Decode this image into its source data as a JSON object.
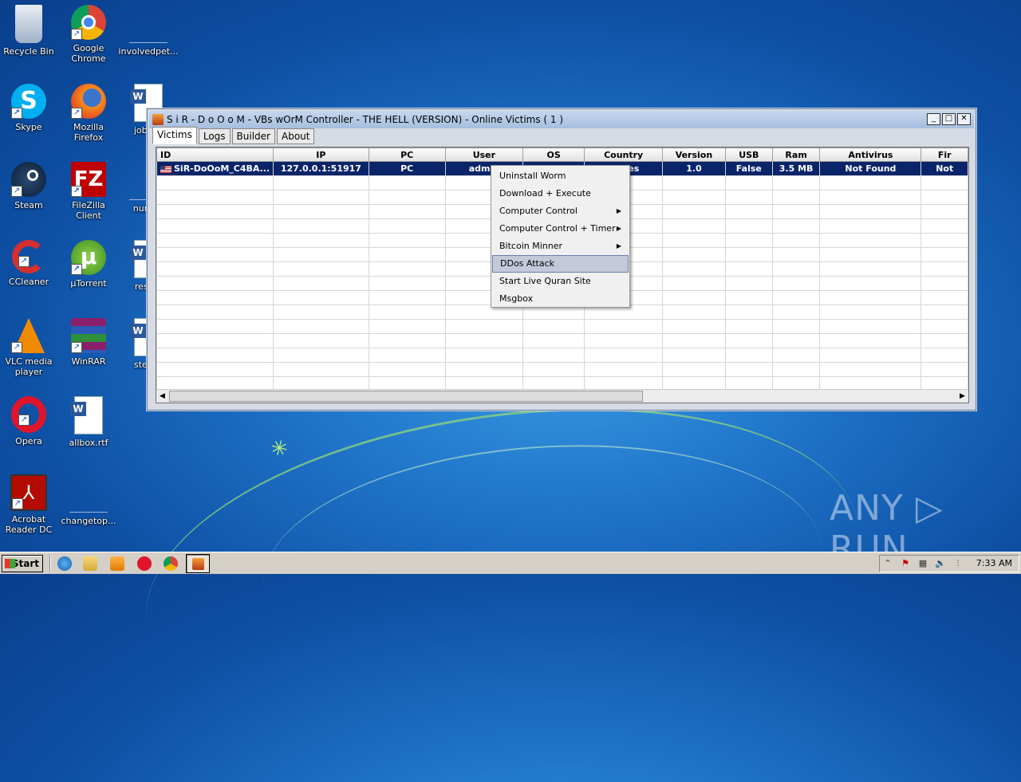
{
  "desktop": {
    "icons": [
      {
        "label": "Recycle Bin",
        "icon": "recycle-bin-icon"
      },
      {
        "label": "Google Chrome",
        "icon": "chrome-icon"
      },
      {
        "label": "involvedpet...",
        "icon": "blank-file-icon"
      },
      {
        "label": "Skype",
        "icon": "skype-icon"
      },
      {
        "label": "Mozilla Firefox",
        "icon": "firefox-icon"
      },
      {
        "label": "jobspe",
        "icon": "word-doc-icon"
      },
      {
        "label": "Steam",
        "icon": "steam-icon"
      },
      {
        "label": "FileZilla Client",
        "icon": "filezilla-icon"
      },
      {
        "label": "numbe",
        "icon": "blank-file-icon"
      },
      {
        "label": "CCleaner",
        "icon": "ccleaner-icon"
      },
      {
        "label": "µTorrent",
        "icon": "utorrent-icon"
      },
      {
        "label": "resulti",
        "icon": "word-doc-icon"
      },
      {
        "label": "VLC media player",
        "icon": "vlc-icon"
      },
      {
        "label": "WinRAR",
        "icon": "winrar-icon"
      },
      {
        "label": "stepse",
        "icon": "word-doc-icon"
      },
      {
        "label": "Opera",
        "icon": "opera-icon"
      },
      {
        "label": "allbox.rtf",
        "icon": "word-doc-icon"
      },
      {
        "label": "Acrobat Reader DC",
        "icon": "acrobat-icon"
      },
      {
        "label": "changetop...",
        "icon": "blank-file-icon"
      }
    ]
  },
  "window": {
    "title": "S i R - D o O o M  - VBs wOrM Controller - THE HELL (VERSION) - Online Victims ( 1 )",
    "controls": {
      "minimize": "_",
      "maximize": "□",
      "close": "✕"
    },
    "tabs": [
      "Victims",
      "Logs",
      "Builder",
      "About"
    ],
    "active_tab": "Victims",
    "table": {
      "columns": [
        "ID",
        "IP",
        "PC",
        "User",
        "OS",
        "Country",
        "Version",
        "USB",
        "Ram",
        "Antivirus",
        "Fir"
      ],
      "rows": [
        [
          "SiR-DoOoM_C4BA...",
          "127.0.0.1:51917",
          "PC",
          "admin",
          "",
          "...ates",
          "1.0",
          "False",
          "3.5 MB",
          "Not Found",
          "Not"
        ]
      ]
    }
  },
  "context_menu": {
    "items": [
      {
        "label": "Uninstall Worm",
        "submenu": false
      },
      {
        "label": "Download + Execute",
        "submenu": false
      },
      {
        "label": "Computer Control",
        "submenu": true
      },
      {
        "label": "Computer Control + Timer",
        "submenu": true
      },
      {
        "label": "Bitcoin Minner",
        "submenu": true
      },
      {
        "label": "DDos Attack",
        "submenu": false,
        "highlighted": true
      },
      {
        "label": "Start Live Quran Site",
        "submenu": false
      },
      {
        "label": "Msgbox",
        "submenu": false
      }
    ]
  },
  "watermark": "ANY ▷ RUN",
  "taskbar": {
    "start_label": "Start",
    "clock": "7:33 AM",
    "tray_chevron": "⌃"
  },
  "colors": {
    "selection": "#0a246a",
    "menu_highlight": "#c3c9d9"
  }
}
